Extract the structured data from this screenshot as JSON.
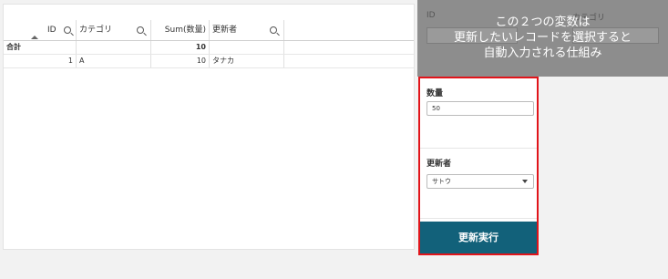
{
  "table": {
    "headers": [
      {
        "label": "ID"
      },
      {
        "label": "カテゴリ"
      },
      {
        "label": "Sum(数量)"
      },
      {
        "label": "更新者"
      }
    ],
    "total_row": {
      "label": "合計",
      "sum": "10"
    },
    "rows": [
      {
        "id": "1",
        "category": "A",
        "sum": "10",
        "user": "タナカ"
      }
    ]
  },
  "variables": {
    "id_label": "ID",
    "category_label": "カテゴリ",
    "overlay_lines": [
      "この２つの変数は",
      "更新したいレコードを選択すると",
      "自動入力される仕組み"
    ]
  },
  "form": {
    "qty_label": "数量",
    "qty_value": "50",
    "user_label": "更新者",
    "user_value": "サトウ",
    "exec_label": "更新実行"
  },
  "colors": {
    "accent": "#e1141a",
    "button": "#12617a"
  }
}
